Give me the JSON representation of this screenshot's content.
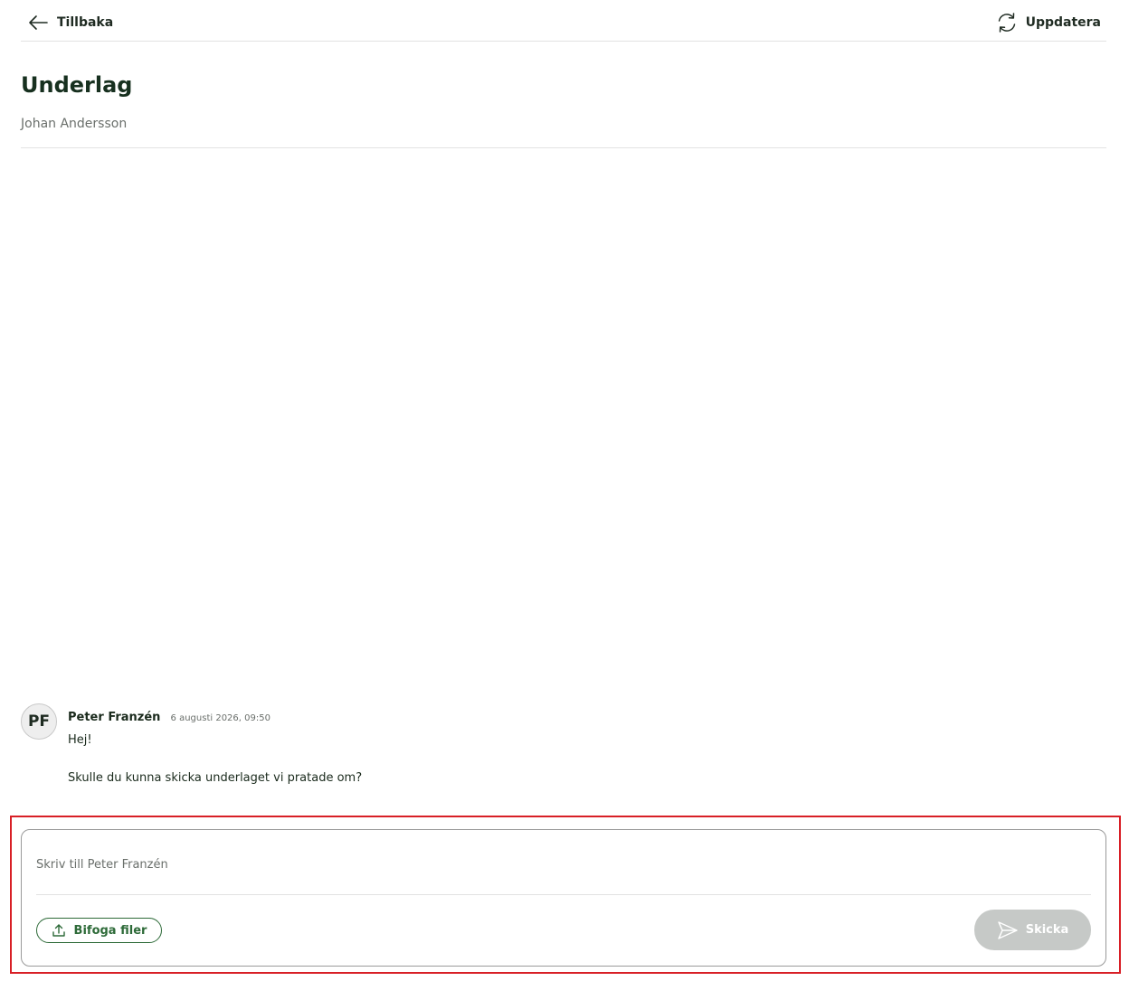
{
  "topbar": {
    "back_label": "Tillbaka",
    "refresh_label": "Uppdatera",
    "icons": {
      "back": "arrow-left-icon",
      "refresh": "refresh-icon"
    }
  },
  "header": {
    "title": "Underlag",
    "subtitle": "Johan Andersson"
  },
  "messages": [
    {
      "avatar_initials": "PF",
      "sender": "Peter Franzén",
      "timestamp": "6 augusti 2026, 09:50",
      "lines": [
        "Hej!",
        "Skulle du kunna skicka underlaget vi pratade om?"
      ]
    }
  ],
  "compose": {
    "value": "",
    "placeholder": "Skriv till Peter Franzén",
    "attach_label": "Bifoga filer",
    "send_label": "Skicka",
    "icons": {
      "attach": "upload-icon",
      "send": "send-icon"
    }
  },
  "colors": {
    "accent_green": "#2d6a38",
    "title_color": "#17301f",
    "send_disabled_bg": "#c6c9c7",
    "highlight_border": "#d81f26"
  }
}
